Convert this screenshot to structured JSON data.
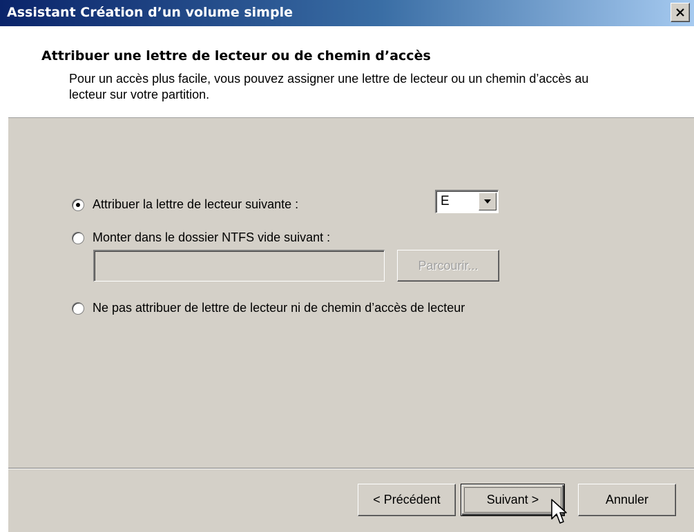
{
  "window": {
    "title": "Assistant Création d’un volume simple",
    "close_glyph": "×"
  },
  "header": {
    "title": "Attribuer une lettre de lecteur ou de chemin d’accès",
    "description": "Pour un accès plus facile, vous pouvez assigner une lettre de lecteur ou un chemin d’accès au lecteur sur votre partition."
  },
  "options": {
    "assign_letter": {
      "label": "Attribuer la lettre de lecteur suivante :",
      "checked": true
    },
    "mount_folder": {
      "label": "Monter dans le dossier NTFS vide suivant :",
      "checked": false
    },
    "no_letter": {
      "label": "Ne pas attribuer de lettre de lecteur ni de chemin d’accès de lecteur",
      "checked": false
    }
  },
  "drive_letter": {
    "value": "E"
  },
  "mount_path": {
    "value": "",
    "browse_label": "Parcourir..."
  },
  "footer": {
    "back_label": "< Précédent",
    "next_label": "Suivant >",
    "cancel_label": "Annuler"
  },
  "icons": {
    "close": "close-icon",
    "dropdown": "chevron-down-icon",
    "cursor": "mouse-pointer-icon"
  },
  "colors": {
    "titlebar_start": "#0a246a",
    "titlebar_end": "#a6caf0",
    "face": "#d4d0c8"
  }
}
